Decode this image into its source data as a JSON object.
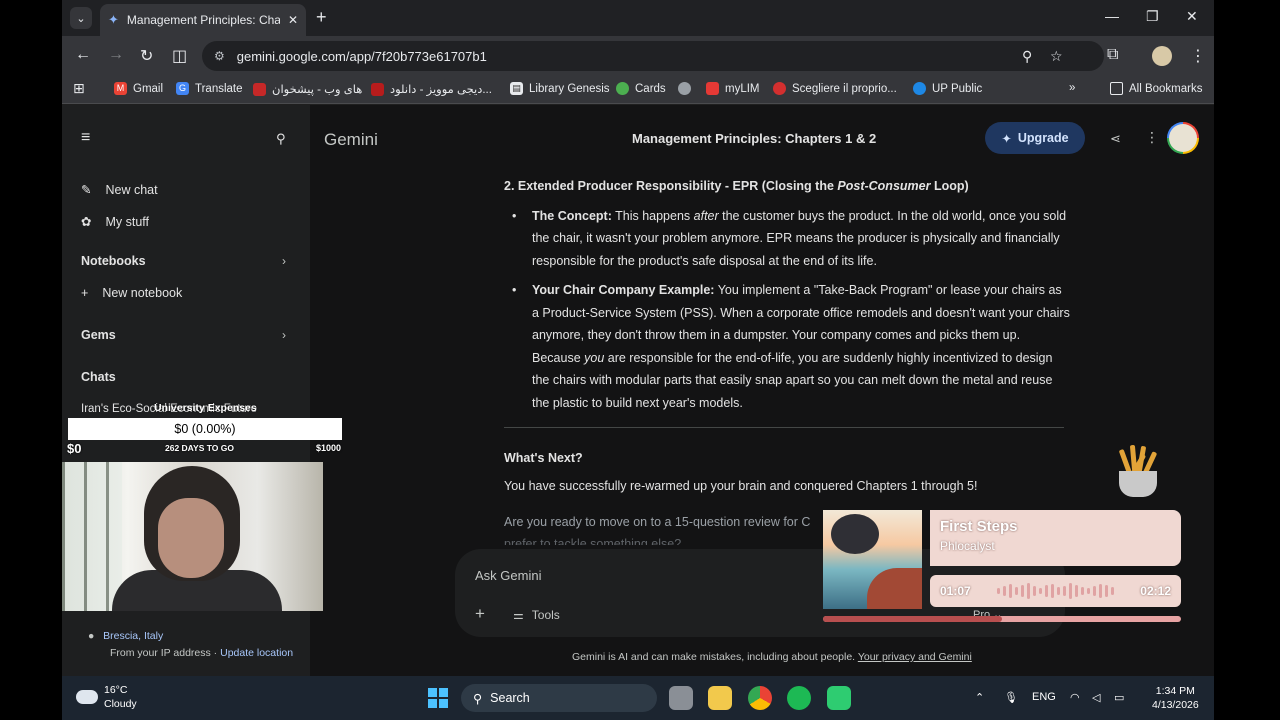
{
  "browser": {
    "tab_title": "Management Principles: Chapters 1 & 2",
    "url": "gemini.google.com/app/7f20b773e61707b1"
  },
  "bookmarks": [
    {
      "label": "Gmail",
      "color": "#ea4335"
    },
    {
      "label": "Translate",
      "color": "#4285f4"
    },
    {
      "label": "های وب - پیشخوان",
      "color": "#c62828"
    },
    {
      "label": "دیجی موویز - دانلود...",
      "color": "#b71c1c"
    },
    {
      "label": "Library Genesis",
      "color": "#e8eaed"
    },
    {
      "label": "Cards",
      "color": "#4caf50"
    },
    {
      "label": "myLIM",
      "color": "#e53935"
    },
    {
      "label": "Scegliere il proprio...",
      "color": "#d32f2f"
    },
    {
      "label": "UP Public",
      "color": "#1e88e5"
    }
  ],
  "bookmarks_right": "All Bookmarks",
  "sidebar": {
    "new_chat": "New chat",
    "my_stuff": "My stuff",
    "notebooks": "Notebooks",
    "new_notebook": "New notebook",
    "gems": "Gems",
    "chats": "Chats",
    "chat_item": "Iran's Eco-Social Economic Future",
    "location_city": "Brescia, Italy",
    "location_source": "From your IP address",
    "location_link": "Update location"
  },
  "header": {
    "logo": "Gemini",
    "title": "Management Principles: Chapters 1 & 2",
    "upgrade": "Upgrade"
  },
  "response": {
    "heading_pre": "2. Extended Producer Responsibility - EPR (Closing the ",
    "heading_em": "Post-Consumer",
    "heading_post": " Loop)",
    "b1_label": "The Concept:",
    "b1_pre": " This happens ",
    "b1_em": "after",
    "b1_post": " the customer buys the product. In the old world, once you sold the chair, it wasn't your problem anymore. EPR means the producer is physically and financially responsible for the product's safe disposal at the end of its life.",
    "b2_label": "Your Chair Company Example:",
    "b2_pre": " You implement a \"Take-Back Program\" or lease your chairs as a Product-Service System (PSS). When a corporate office remodels and doesn't want your chairs anymore, they don't throw them in a dumpster. Your company comes and picks them up. Because ",
    "b2_em": "you",
    "b2_post": " are responsible for the end-of-life, you are suddenly highly incentivized to design the chairs with modular parts that easily snap apart so you can melt down the metal and reuse the plastic to build next year's models.",
    "next_heading": "What's Next?",
    "next_body": "You have successfully re-warmed up your brain and conquered Chapters 1 through 5!",
    "next_question": "Are you ready to move on to a 15-question review for C",
    "next_question_2": "prefer to tackle something else?"
  },
  "input": {
    "placeholder": "Ask Gemini",
    "tools": "Tools",
    "mode": "Pro"
  },
  "disclaimer": {
    "text": "Gemini is AI and can make mistakes, including about people. ",
    "link": "Your privacy and Gemini"
  },
  "overlay": {
    "goal_title": "University Expenses",
    "goal_value": "$0 (0.00%)",
    "goal_min": "$0",
    "goal_days": "262 DAYS TO GO",
    "goal_max": "$1000"
  },
  "player": {
    "song": "First Steps",
    "artist": "Phlocalyst",
    "elapsed": "01:07",
    "duration": "02:12",
    "progress": 0.5
  },
  "taskbar": {
    "temp": "16°C",
    "condition": "Cloudy",
    "search": "Search",
    "lang": "ENG",
    "time": "1:34 PM",
    "date": "4/13/2026"
  }
}
